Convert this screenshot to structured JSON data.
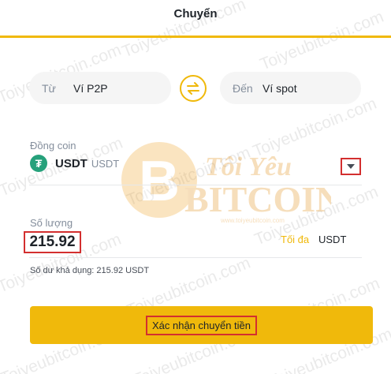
{
  "header": {
    "title": "Chuyển"
  },
  "transfer": {
    "from_label": "Từ",
    "from_value": "Ví P2P",
    "to_label": "Đến",
    "to_value": "Ví spot"
  },
  "coin": {
    "label": "Đồng coin",
    "symbol": "USDT",
    "name": "USDT",
    "icon": "tether-icon"
  },
  "quantity": {
    "label": "Số lượng",
    "value": "215.92",
    "max_label": "Tối đa",
    "unit": "USDT"
  },
  "balance": {
    "text": "Số dư khả dụng: 215.92 USDT"
  },
  "confirm": {
    "label": "Xác nhận chuyển tiền"
  },
  "watermark": {
    "text": "Toiyeubitcoin.com",
    "logo_text": "Tôi Yêu BITCOIN",
    "logo_subtext": "www.toiyeubitcoin.com"
  },
  "colors": {
    "accent": "#f0b90b",
    "tether": "#26a17b",
    "highlight": "#d32f2f"
  }
}
